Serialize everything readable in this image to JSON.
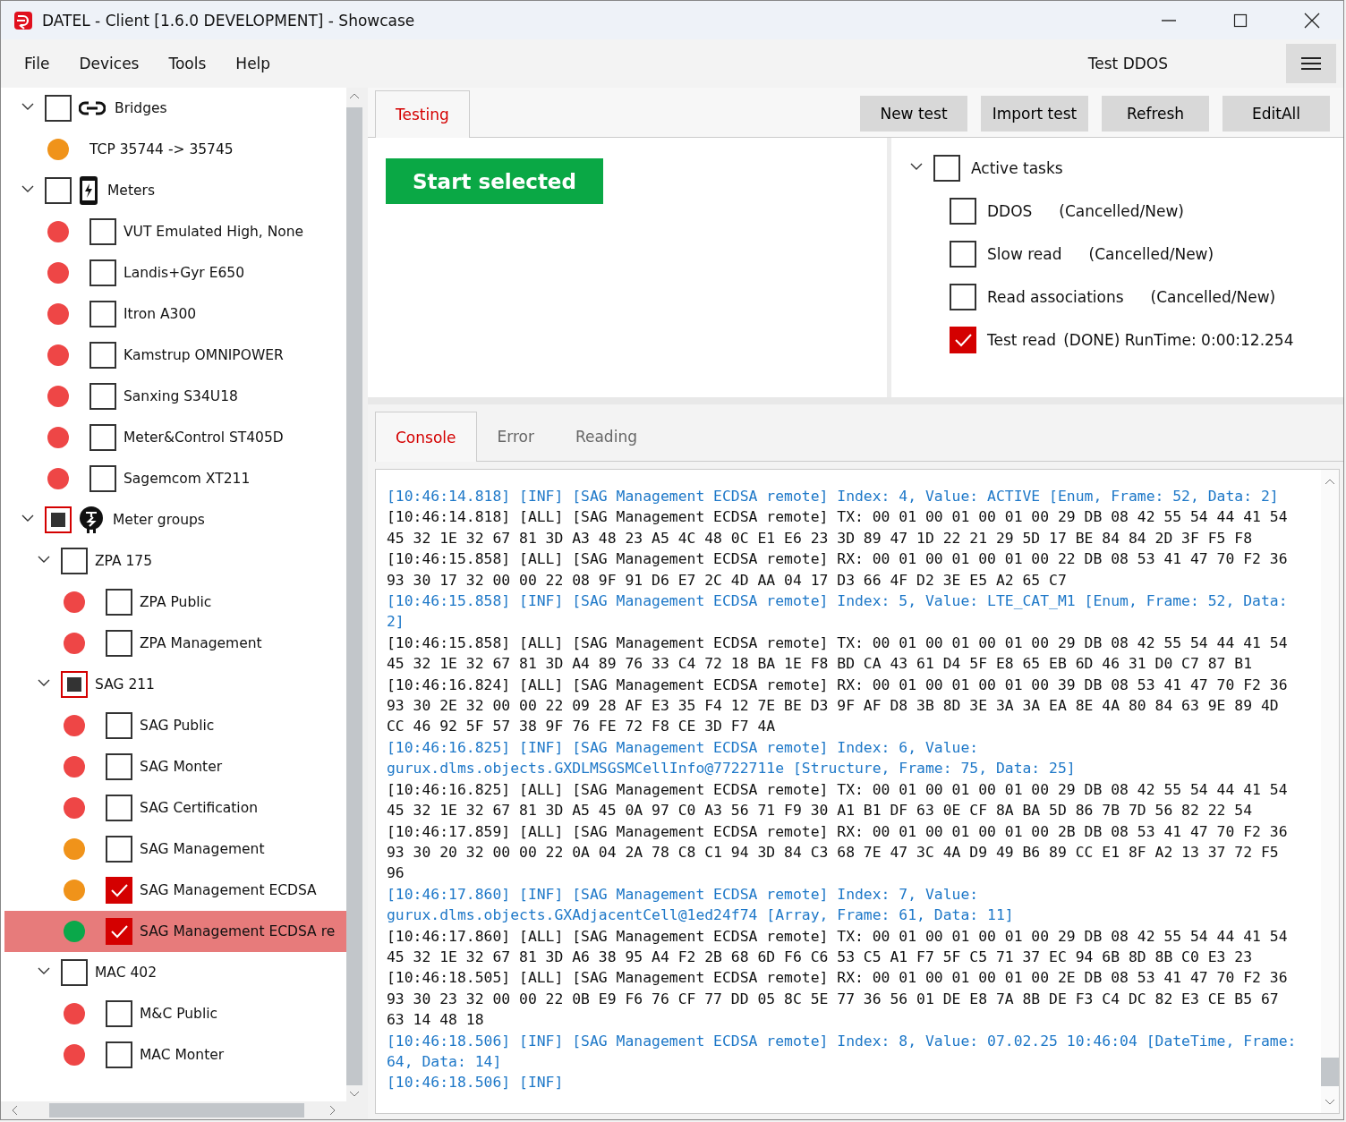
{
  "window": {
    "title": "DATEL - Client [1.6.0 DEVELOPMENT] - Showcase"
  },
  "menu": [
    "File",
    "Devices",
    "Tools",
    "Help"
  ],
  "profile": "Test DDOS",
  "tree": [
    {
      "label": "Bridges",
      "kind": "link",
      "checked": false,
      "partial": false,
      "expanded": true,
      "selected": false,
      "children": [
        {
          "label": "TCP 35744 -> 35745",
          "color": "#f0931a",
          "selected": false
        }
      ]
    },
    {
      "label": "Meters",
      "kind": "meter",
      "checked": false,
      "partial": false,
      "expanded": true,
      "selected": false,
      "children": [
        {
          "label": "VUT Emulated High, None",
          "color": "#ee4646",
          "checked": false,
          "selected": false
        },
        {
          "label": "Landis+Gyr E650",
          "color": "#ee4646",
          "checked": false,
          "selected": false
        },
        {
          "label": "Itron A300",
          "color": "#ee4646",
          "checked": false,
          "selected": false
        },
        {
          "label": "Kamstrup OMNIPOWER",
          "color": "#ee4646",
          "checked": false,
          "selected": false
        },
        {
          "label": "Sanxing S34U18",
          "color": "#ee4646",
          "checked": false,
          "selected": false
        },
        {
          "label": "Meter&Control ST405D",
          "color": "#ee4646",
          "checked": false,
          "selected": false
        },
        {
          "label": "Sagemcom XT211",
          "color": "#ee4646",
          "checked": false,
          "selected": false
        }
      ]
    },
    {
      "label": "Meter groups",
      "kind": "meter-group",
      "checked": false,
      "partial": true,
      "expanded": true,
      "selected": false,
      "children": [
        {
          "label": "ZPA 175",
          "checked": false,
          "partial": false,
          "expanded": true,
          "selected": false,
          "children": [
            {
              "label": "ZPA Public",
              "color": "#ee4646",
              "checked": false,
              "selected": false
            },
            {
              "label": "ZPA Management",
              "color": "#ee4646",
              "checked": false,
              "selected": false
            }
          ]
        },
        {
          "label": "SAG 211",
          "checked": false,
          "partial": true,
          "expanded": true,
          "selected": false,
          "children": [
            {
              "label": "SAG Public",
              "color": "#ee4646",
              "checked": false,
              "selected": false
            },
            {
              "label": "SAG Monter",
              "color": "#ee4646",
              "checked": false,
              "selected": false
            },
            {
              "label": "SAG Certification",
              "color": "#ee4646",
              "checked": false,
              "selected": false
            },
            {
              "label": "SAG Management",
              "color": "#f0931a",
              "checked": false,
              "selected": false
            },
            {
              "label": "SAG Management ECDSA",
              "color": "#f0931a",
              "checked": true,
              "selected": false
            },
            {
              "label": "SAG Management ECDSA re",
              "color": "#0aa84a",
              "checked": true,
              "selected": true
            }
          ]
        },
        {
          "label": "MAC 402",
          "checked": false,
          "partial": false,
          "expanded": true,
          "selected": false,
          "children": [
            {
              "label": "M&C Public",
              "color": "#ee4646",
              "checked": false,
              "selected": false
            },
            {
              "label": "MAC Monter",
              "color": "#ee4646",
              "checked": false,
              "selected": false
            }
          ]
        }
      ]
    }
  ],
  "top_tabs": [
    {
      "label": "Testing",
      "selected": true
    }
  ],
  "toolbar_buttons": [
    "New test",
    "Import test",
    "Refresh",
    "EditAll"
  ],
  "start_button": "Start selected",
  "tasks": {
    "label": "Active tasks",
    "checked": false,
    "expanded": true,
    "items": [
      {
        "name": "DDOS",
        "status": "(Cancelled/New)",
        "checked": false
      },
      {
        "name": "Slow read",
        "status": "(Cancelled/New)",
        "checked": false
      },
      {
        "name": "Read associations",
        "status": "(Cancelled/New)",
        "checked": false
      },
      {
        "name": "Test read",
        "status": "(DONE) RunTime: 0:00:12.254",
        "checked": true
      }
    ]
  },
  "bottom_tabs": [
    {
      "label": "Console",
      "selected": true
    },
    {
      "label": "Error",
      "selected": false
    },
    {
      "label": "Reading",
      "selected": false
    }
  ],
  "log": [
    {
      "kind": "inf",
      "text": "[10:46:14.818] [INF] [SAG Management ECDSA remote] Index: 4, Value: ACTIVE [Enum, Frame: 52, Data: 2]"
    },
    {
      "kind": "all",
      "text": "[10:46:14.818] [ALL] [SAG Management ECDSA remote] TX: 00 01 00 01 00 01 00 29 DB 08 42 55 54 44 41 54 45 32 1E 32 67 81 3D A3 48 23 A5 4C 48 0C E1 E6 23 3D 89 47 1D 22 21 29 5D 17 BE 84 84 2D 3F F5 F8"
    },
    {
      "kind": "all",
      "text": "[10:46:15.858] [ALL] [SAG Management ECDSA remote] RX: 00 01 00 01 00 01 00 22 DB 08 53 41 47 70 F2 36 93 30 17 32 00 00 22 08 9F 91 D6 E7 2C 4D AA 04 17 D3 66 4F D2 3E E5 A2 65 C7"
    },
    {
      "kind": "inf",
      "text": "[10:46:15.858] [INF] [SAG Management ECDSA remote] Index: 5, Value: LTE_CAT_M1 [Enum, Frame: 52, Data: 2]"
    },
    {
      "kind": "all",
      "text": "[10:46:15.858] [ALL] [SAG Management ECDSA remote] TX: 00 01 00 01 00 01 00 29 DB 08 42 55 54 44 41 54 45 32 1E 32 67 81 3D A4 89 76 33 C4 72 18 BA 1E F8 BD CA 43 61 D4 5F E8 65 EB 6D 46 31 D0 C7 87 B1"
    },
    {
      "kind": "all",
      "text": "[10:46:16.824] [ALL] [SAG Management ECDSA remote] RX: 00 01 00 01 00 01 00 39 DB 08 53 41 47 70 F2 36 93 30 2E 32 00 00 22 09 28 AF E3 35 F4 12 7E BE D3 9F AF D8 3B 8D 3E 3A 3A EA 8E 4A 80 84 63 9E 89 4D CC 46 92 5F 57 38 9F 76 FE 72 F8 CE 3D F7 4A"
    },
    {
      "kind": "inf",
      "text": "[10:46:16.825] [INF] [SAG Management ECDSA remote] Index: 6, Value: gurux.dlms.objects.GXDLMSGSMCellInfo@7722711e [Structure, Frame: 75, Data: 25]"
    },
    {
      "kind": "all",
      "text": "[10:46:16.825] [ALL] [SAG Management ECDSA remote] TX: 00 01 00 01 00 01 00 29 DB 08 42 55 54 44 41 54 45 32 1E 32 67 81 3D A5 45 0A 97 C0 A3 56 71 F9 30 A1 B1 DF 63 0E CF 8A BA 5D 86 7B 7D 56 82 22 54"
    },
    {
      "kind": "all",
      "text": "[10:46:17.859] [ALL] [SAG Management ECDSA remote] RX: 00 01 00 01 00 01 00 2B DB 08 53 41 47 70 F2 36 93 30 20 32 00 00 22 0A 04 2A 78 C8 C1 94 3D 84 C3 68 7E 47 3C 4A D9 49 B6 89 CC E1 8F A2 13 37 72 F5 96"
    },
    {
      "kind": "inf",
      "text": "[10:46:17.860] [INF] [SAG Management ECDSA remote] Index: 7, Value: gurux.dlms.objects.GXAdjacentCell@1ed24f74 [Array, Frame: 61, Data: 11]"
    },
    {
      "kind": "all",
      "text": "[10:46:17.860] [ALL] [SAG Management ECDSA remote] TX: 00 01 00 01 00 01 00 29 DB 08 42 55 54 44 41 54 45 32 1E 32 67 81 3D A6 38 95 A4 F2 2B 68 6D F6 C6 53 C5 A1 F7 5F C5 71 37 EC 94 6B 8D 8B C0 E3 23"
    },
    {
      "kind": "all",
      "text": "[10:46:18.505] [ALL] [SAG Management ECDSA remote] RX: 00 01 00 01 00 01 00 2E DB 08 53 41 47 70 F2 36 93 30 23 32 00 00 22 0B E9 F6 76 CF 77 DD 05 8C 5E 77 36 56 01 DE E8 7A 8B DE F3 C4 DC 82 E3 CE B5 67 63 14 48 18"
    },
    {
      "kind": "inf",
      "text": "[10:46:18.506] [INF] [SAG Management ECDSA remote] Index: 8, Value: 07.02.25 10:46:04 [DateTime, Frame: 64, Data: 14]"
    },
    {
      "kind": "inf",
      "text": "[10:46:18.506] [INF]"
    }
  ]
}
